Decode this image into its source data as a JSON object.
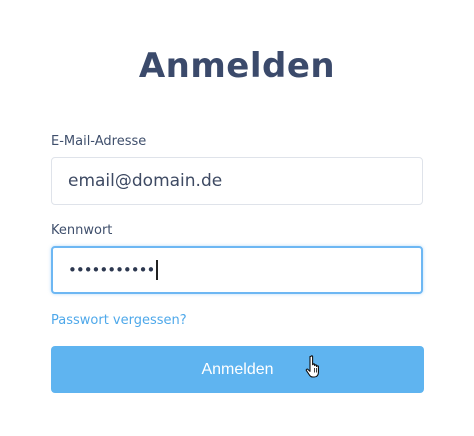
{
  "login": {
    "title": "Anmelden",
    "email_label": "E-Mail-Adresse",
    "email_value": "email@domain.de",
    "password_label": "Kennwort",
    "password_value": "•••••••••••",
    "forgot_link": "Passwort vergessen?",
    "submit_label": "Anmelden"
  },
  "colors": {
    "title": "#3b4a6b",
    "accent": "#5fb4f0",
    "link": "#4ea8ea",
    "focus_border": "#6db7f3"
  },
  "icons": {
    "cursor": "hand-pointer-icon"
  }
}
